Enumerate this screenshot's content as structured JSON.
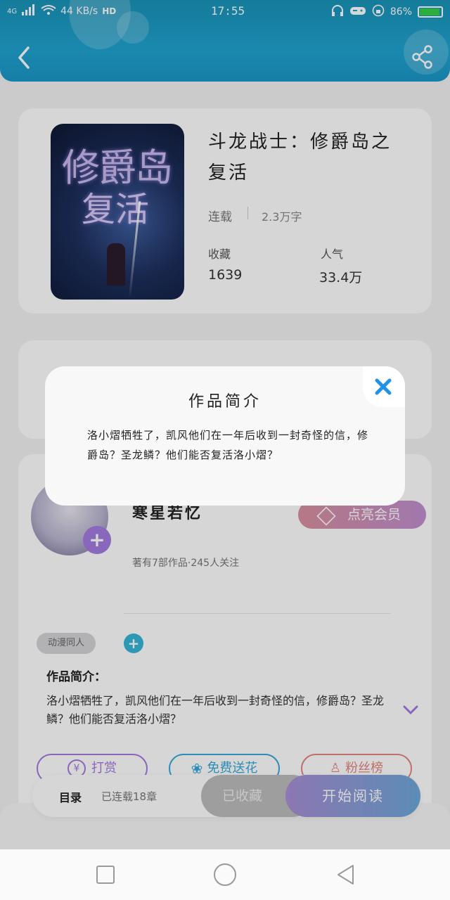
{
  "status_bar": {
    "network": "4G",
    "speed": "44 KB/s",
    "hd": "HD",
    "time": "17:55",
    "battery": "86%",
    "battery_level": 0.86
  },
  "book": {
    "title": "斗龙战士：修爵岛之复活",
    "status": "连载",
    "word_count": "2.3万字",
    "favorites_label": "收藏",
    "favorites_value": "1639",
    "popularity_label": "人气",
    "popularity_value": "33.4万",
    "cover_text_1": "修爵岛",
    "cover_text_2": "复活"
  },
  "author": {
    "name": "寒星若忆",
    "stats": "著有7部作品·245人关注",
    "member_button": "点亮会员"
  },
  "tag": "动漫同人",
  "intro": {
    "section_title": "作品简介：",
    "text": "洛小熠牺牲了，凯风他们在一年后收到一封奇怪的信，修爵岛？圣龙鳞？他们能否复活洛小熠？"
  },
  "actions": {
    "reward": "打赏",
    "flower": "免费送花",
    "fans": "粉丝榜"
  },
  "bottom": {
    "catalog": "目录",
    "chapters": "已连载18章",
    "collected": "已收藏",
    "start_reading": "开始阅读"
  },
  "modal": {
    "title": "作品简介",
    "body": "洛小熠牺牲了，凯风他们在一年后收到一封奇怪的信，修爵岛？圣龙鳞？他们能否复活洛小熠？"
  },
  "icons": [
    "back-icon",
    "share-icon",
    "close-icon",
    "plus-icon",
    "diamond-icon",
    "chevron-down-icon",
    "yen-icon",
    "flower-icon",
    "user-icon"
  ],
  "colors": {
    "header": "#1fa3d0",
    "member": "#c090cf",
    "plus_badge": "#a27be0",
    "tag_plus": "#35b5d6",
    "reward": "#a27be0",
    "flower": "#35a9d9",
    "fans": "#e5857f",
    "close": "#1f93e8"
  }
}
